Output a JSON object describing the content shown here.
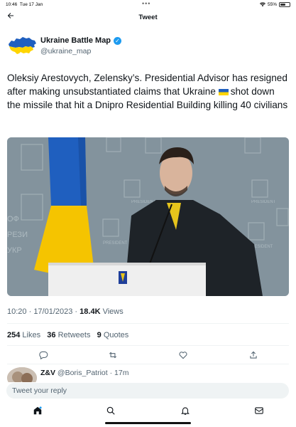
{
  "status_bar": {
    "time": "10:46",
    "date": "Tue 17 Jan",
    "dots": "•••",
    "battery_text": "55%",
    "battery_level": 0.55
  },
  "header": {
    "back_icon": "back-arrow-icon",
    "title": "Tweet"
  },
  "author": {
    "name": "Ukraine Battle Map",
    "handle": "@ukraine_map",
    "verified": true
  },
  "tweet": {
    "text_before_flag": "Oleksiy Arestovych, Zelensky’s. Presidential Advisor has resigned after making unsubstantiated claims that Ukraine",
    "text_after_flag": "shot down the missile that hit a Dnipro Residential Building killing 40 civilians"
  },
  "meta": {
    "time": "10:20",
    "sep": " · ",
    "date": "17/01/2023",
    "views_count": "18.4K",
    "views_label": "Views"
  },
  "stats": {
    "likes_count": "254",
    "likes_label": "Likes",
    "retweets_count": "36",
    "retweets_label": "Retweets",
    "quotes_count": "9",
    "quotes_label": "Quotes"
  },
  "actions": [
    "reply-icon",
    "retweet-icon",
    "like-icon",
    "share-icon"
  ],
  "reply_preview": {
    "name": "Z&V",
    "handle": "@Boris_Patriot",
    "sep": " · ",
    "time": "17m"
  },
  "reply_box": {
    "placeholder": "Tweet your reply"
  },
  "tabbar": [
    "home-icon",
    "search-icon",
    "notifications-icon",
    "messages-icon"
  ],
  "colors": {
    "accent": "#1d9bf0",
    "flag_blue": "#1f5fbf",
    "flag_yellow": "#ffd500",
    "text": "#0f1419",
    "secondary": "#536471"
  }
}
